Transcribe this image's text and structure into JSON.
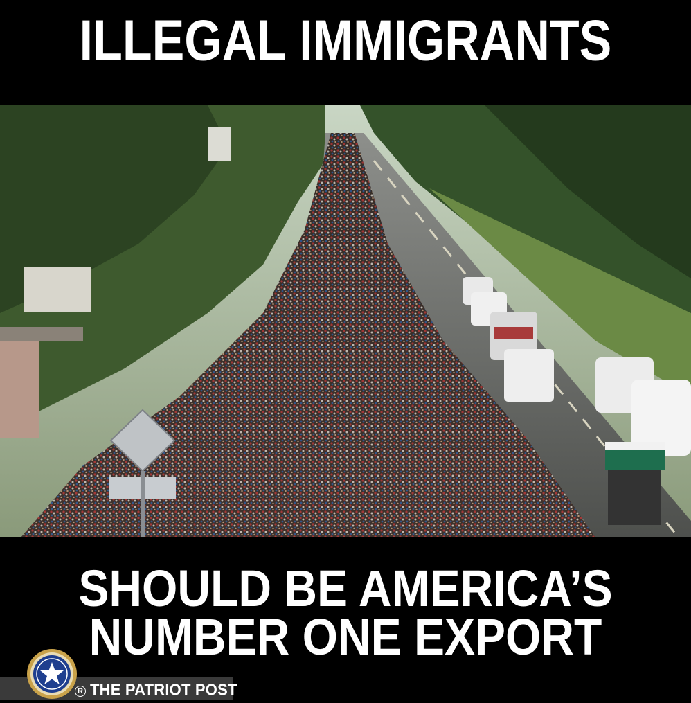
{
  "meme": {
    "top_text": "ILLEGAL IMMIGRANTS",
    "bottom_text_line1": "SHOULD BE AMERICA’S",
    "bottom_text_line2": "NUMBER ONE EXPORT"
  },
  "watermark": {
    "brand_name": "THE PATRIOT POST",
    "registered_mark": "R"
  },
  "photo": {
    "subject": "large crowd walking along a highway with trees on both sides and vehicles on the right lane"
  },
  "colors": {
    "background": "#000000",
    "text": "#ffffff",
    "seal_ring": "#c9a24a",
    "seal_center": "#1f3f8f"
  }
}
